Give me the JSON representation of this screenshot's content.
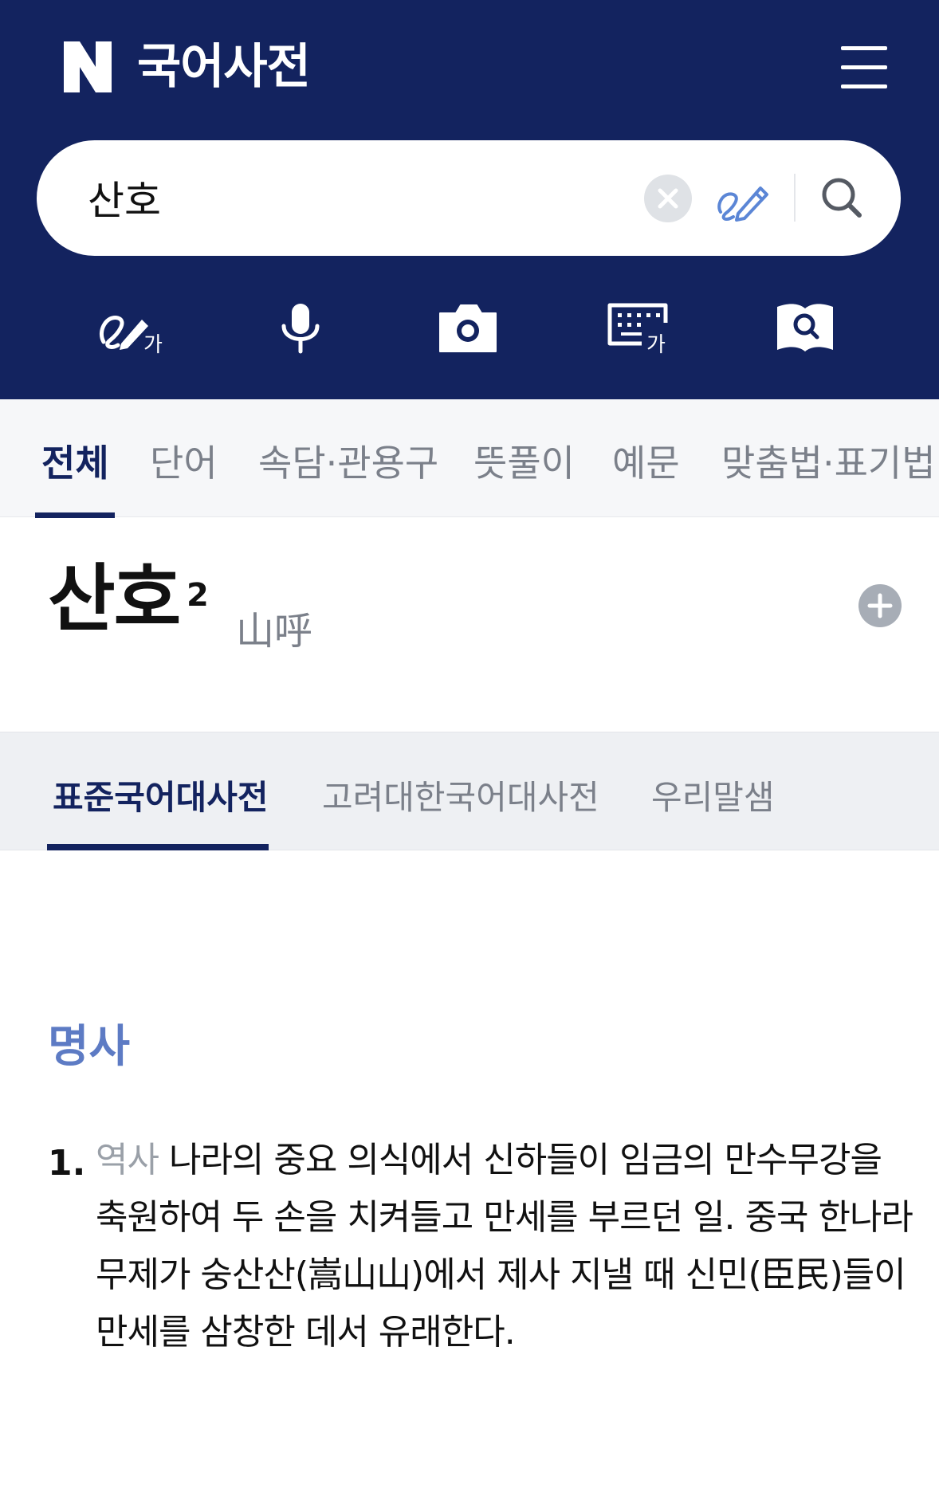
{
  "header": {
    "app_title": "국어사전",
    "logo_letter": "N",
    "menu_icon": "hamburger-menu-icon"
  },
  "search": {
    "value": "산호",
    "clear_icon": "clear-icon",
    "handwrite_icon": "handwriting-icon",
    "search_icon": "search-icon"
  },
  "tools": [
    {
      "name": "handwriting-input",
      "icon": "handwriting-ga-icon",
      "badge": "가"
    },
    {
      "name": "voice-input",
      "icon": "microphone-icon"
    },
    {
      "name": "camera-input",
      "icon": "camera-icon"
    },
    {
      "name": "keyboard-input",
      "icon": "keyboard-ga-icon",
      "badge": "가"
    },
    {
      "name": "book-search",
      "icon": "book-search-icon"
    }
  ],
  "category_tabs": [
    {
      "label": "전체",
      "active": true
    },
    {
      "label": "단어"
    },
    {
      "label": "속담·관용구"
    },
    {
      "label": "뜻풀이"
    },
    {
      "label": "예문"
    },
    {
      "label": "맞춤법·표기법"
    }
  ],
  "entry": {
    "word": "산호",
    "superscript": "2",
    "hanja": "山呼",
    "add_icon": "plus-icon"
  },
  "dict_tabs": [
    {
      "label": "표준국어대사전",
      "active": true
    },
    {
      "label": "고려대한국어대사전"
    },
    {
      "label": "우리말샘"
    }
  ],
  "definition": {
    "part_of_speech": "명사",
    "items": [
      {
        "number": "1.",
        "field": "역사",
        "text": "나라의 중요 의식에서 신하들이 임금의 만수무강을 축원하여 두 손을 치켜들고 만세를 부르던 일. 중국 한나라 무제가 숭산산(嵩山山)에서 제사 지낼 때 신민(臣民)들이 만세를 삼창한 데서 유래한다."
      }
    ]
  },
  "colors": {
    "header_bg": "#13235f",
    "accent": "#13235f",
    "pos_blue": "#5d7bc4",
    "muted_text": "#7b808a"
  }
}
